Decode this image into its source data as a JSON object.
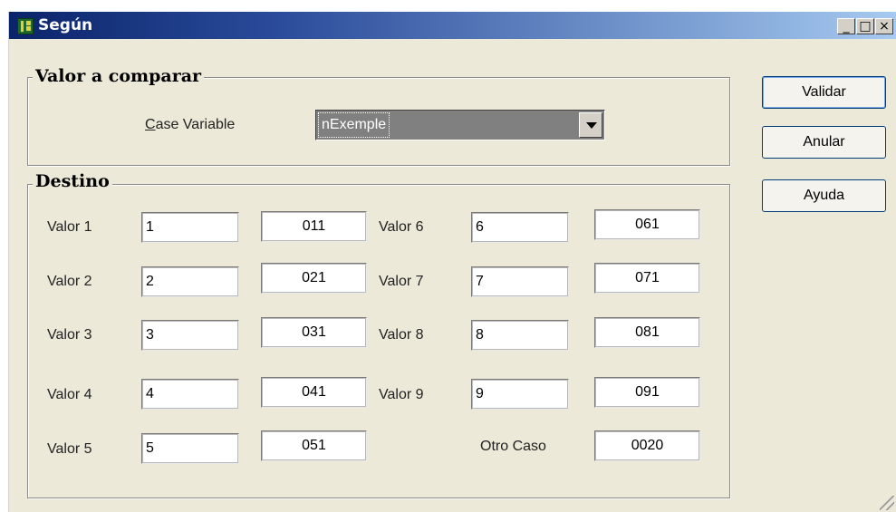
{
  "window": {
    "title": "Según",
    "controls": {
      "minimize": "_",
      "maximize": "□",
      "close": "×"
    }
  },
  "groups": {
    "compare": {
      "title": "Valor a comparar"
    },
    "destino": {
      "title": "Destino"
    }
  },
  "case_variable": {
    "label_first": "C",
    "label_rest": "ase Variable",
    "value": "nExemple"
  },
  "left_column": [
    {
      "label": "Valor 1",
      "value": "1",
      "dest": "011"
    },
    {
      "label": "Valor 2",
      "value": "2",
      "dest": "021"
    },
    {
      "label": "Valor 3",
      "value": "3",
      "dest": "031"
    },
    {
      "label": "Valor 4",
      "value": "4",
      "dest": "041"
    },
    {
      "label": "Valor 5",
      "value": "5",
      "dest": "051"
    }
  ],
  "right_column": [
    {
      "label": "Valor 6",
      "value": "6",
      "dest": "061"
    },
    {
      "label": "Valor 7",
      "value": "7",
      "dest": "071"
    },
    {
      "label": "Valor 8",
      "value": "8",
      "dest": "081"
    },
    {
      "label": "Valor 9",
      "value": "9",
      "dest": "091"
    }
  ],
  "otro_caso": {
    "label": "Otro Caso",
    "dest": "0020"
  },
  "buttons": {
    "validar": "Validar",
    "anular": "Anular",
    "ayuda": "Ayuda"
  }
}
